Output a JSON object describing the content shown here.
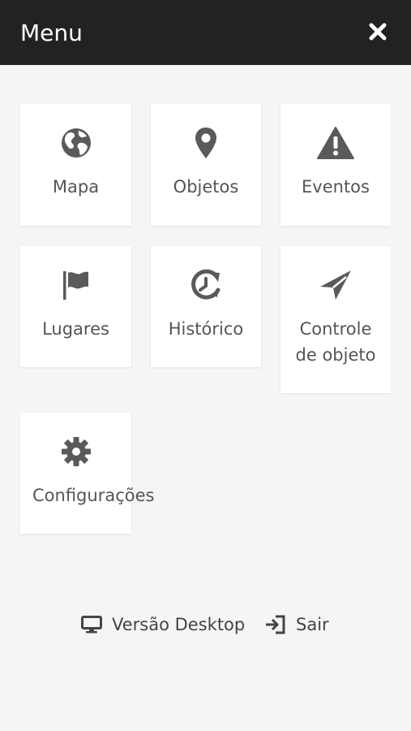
{
  "header": {
    "title": "Menu",
    "close_icon": "close-icon"
  },
  "tiles": [
    {
      "label": "Mapa",
      "icon": "globe-icon"
    },
    {
      "label": "Objetos",
      "icon": "map-marker-icon"
    },
    {
      "label": "Eventos",
      "icon": "warning-icon"
    },
    {
      "label": "Lugares",
      "icon": "flag-icon"
    },
    {
      "label": "Histórico",
      "icon": "history-icon"
    },
    {
      "label_line1": "Controle",
      "label_line2": "de objeto",
      "icon": "paper-plane-icon"
    },
    {
      "label": "Configurações",
      "icon": "gear-icon"
    }
  ],
  "footer": {
    "desktop_label": "Versão Desktop",
    "desktop_icon": "desktop-icon",
    "logout_label": "Sair",
    "logout_icon": "sign-in-icon"
  },
  "colors": {
    "header_bg": "#222222",
    "page_bg": "#f5f5f5",
    "tile_bg": "#ffffff",
    "icon": "#5a5a5a",
    "text": "#555555"
  }
}
